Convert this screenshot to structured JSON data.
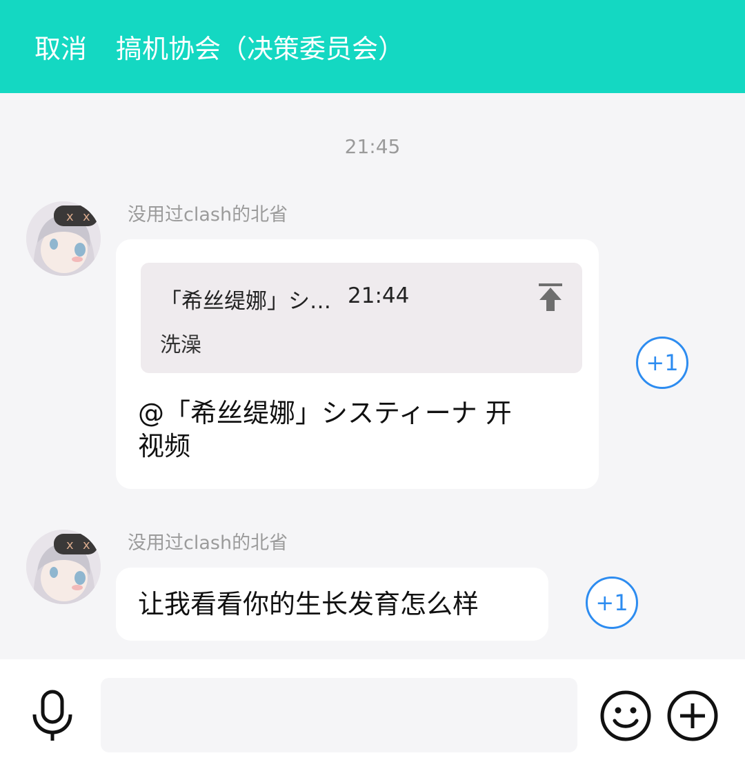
{
  "header": {
    "cancel_label": "取消",
    "title": "搞机协会（决策委员会）"
  },
  "timestamp": "21:45",
  "messages": [
    {
      "sender": "没用过clash的北省",
      "quote": {
        "name": "「希丝缇娜」シ…",
        "time": "21:44",
        "text": "洗澡"
      },
      "text_line1": "@「希丝缇娜」システィーナ 开",
      "text_line2": "视频",
      "plus_label": "+1"
    },
    {
      "sender": "没用过clash的北省",
      "text": "让我看看你的生长发育怎么样",
      "plus_label": "+1"
    }
  ],
  "input": {
    "value": "",
    "placeholder": ""
  },
  "icons": {
    "mic": "microphone-icon",
    "emoji": "smiley-icon",
    "plus": "plus-icon",
    "pin": "pin-top-icon"
  },
  "colors": {
    "header_bg": "#14d8c2",
    "plusone": "#2d8cf0",
    "background": "#f5f5f7"
  }
}
